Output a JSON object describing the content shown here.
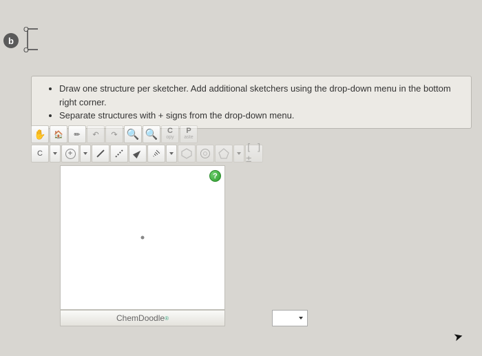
{
  "question": {
    "label": "b"
  },
  "instructions": [
    "Draw one structure per sketcher. Add additional sketchers using the drop-down menu in the bottom right corner.",
    "Separate structures with + signs from the drop-down menu."
  ],
  "toolbar1": {
    "hand": "✋",
    "home": "🏠",
    "pencil": "✏",
    "undo": "↶",
    "redo": "↷",
    "zoom_in": "+",
    "zoom_out": "−",
    "copy": {
      "top": "C",
      "bot": "opy"
    },
    "paste": {
      "top": "P",
      "bot": "aste"
    }
  },
  "toolbar2": {
    "element": "C",
    "charges": "⊕",
    "bond_label": "/",
    "dotted_bond": "⋯",
    "brackets": "[ ]±"
  },
  "brand": "ChemDoodle",
  "help": "?"
}
